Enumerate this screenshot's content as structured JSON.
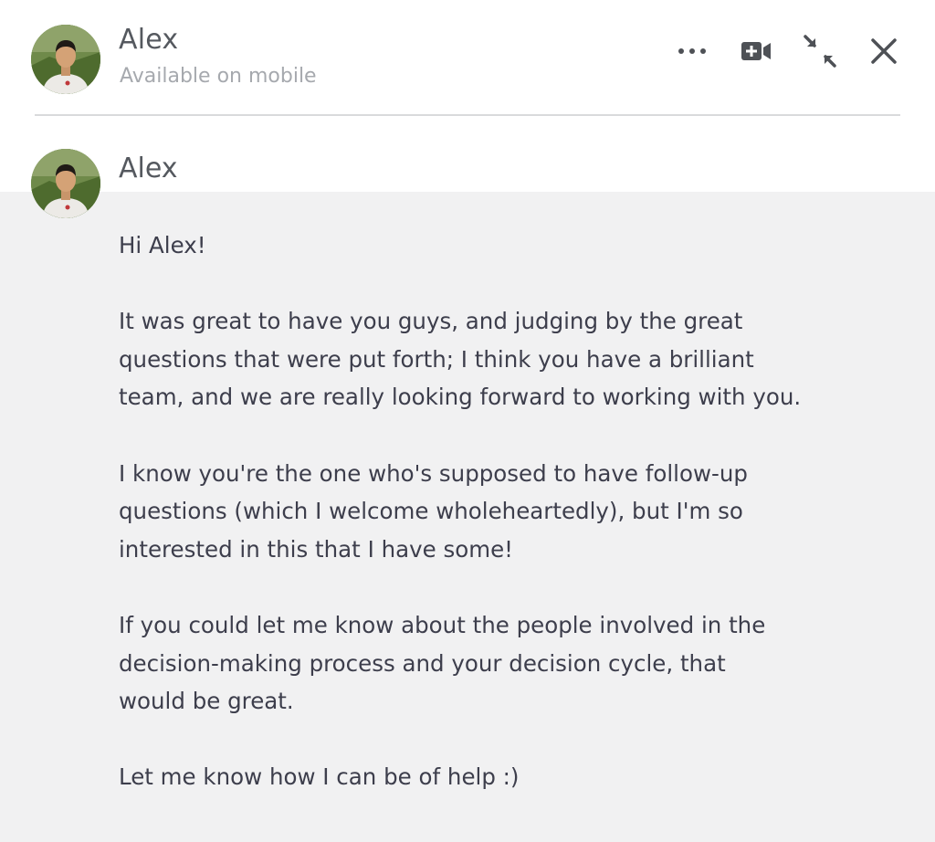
{
  "contact": {
    "name": "Alex",
    "status": "Available on mobile",
    "avatar_icon": "person-avatar"
  },
  "actions": [
    {
      "icon": "more-options-icon",
      "label": "More options"
    },
    {
      "icon": "video-call-icon",
      "label": "Start video call"
    },
    {
      "icon": "minimize-icon",
      "label": "Minimize"
    },
    {
      "icon": "close-icon",
      "label": "Close"
    }
  ],
  "message": {
    "sender": "Alex",
    "paragraphs": [
      "Hi Alex!",
      "It was great to have you guys, and judging by the great\nquestions that were put forth; I think you have a brilliant\nteam, and we are really looking forward to working with you.",
      "I know you're the one who's supposed to have follow-up\nquestions (which I welcome wholeheartedly), but I'm so\ninterested in this that I have some!",
      "If you could let me know about the people involved in the\ndecision-making process and your decision cycle, that\nwould be great.",
      "Let me know how I can be of help :)"
    ]
  },
  "colors": {
    "message_background": "#f1f1f2",
    "message_text": "#3d3e4c",
    "icon": "#4e5156",
    "status_text": "#a6a9ae"
  }
}
